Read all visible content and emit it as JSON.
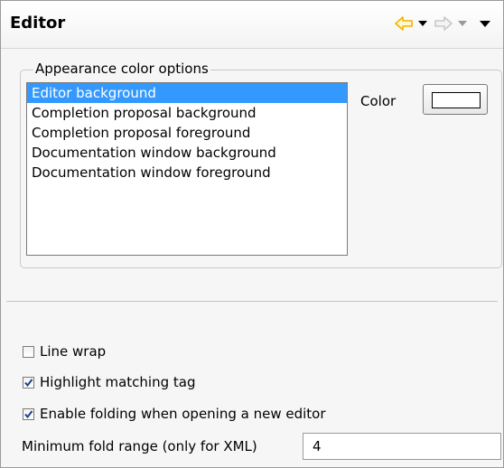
{
  "header": {
    "title": "Editor"
  },
  "appearance": {
    "group_label": "Appearance color options",
    "items": [
      "Editor background",
      "Completion proposal background",
      "Completion proposal foreground",
      "Documentation window background",
      "Documentation window foreground"
    ],
    "selected_index": 0,
    "color_label": "Color",
    "color_value": "#ffffff"
  },
  "options": {
    "line_wrap": {
      "label": "Line wrap",
      "checked": false
    },
    "highlight_matching_tag": {
      "label": "Highlight matching tag",
      "checked": true
    },
    "enable_folding": {
      "label": "Enable folding when opening a new editor",
      "checked": true
    }
  },
  "fold_range": {
    "label": "Minimum fold range (only for XML)",
    "value": "4"
  },
  "colors": {
    "selection": "#3399ff",
    "back_arrow": "#f0b400",
    "forward_arrow_disabled": "#c8c8c8"
  }
}
